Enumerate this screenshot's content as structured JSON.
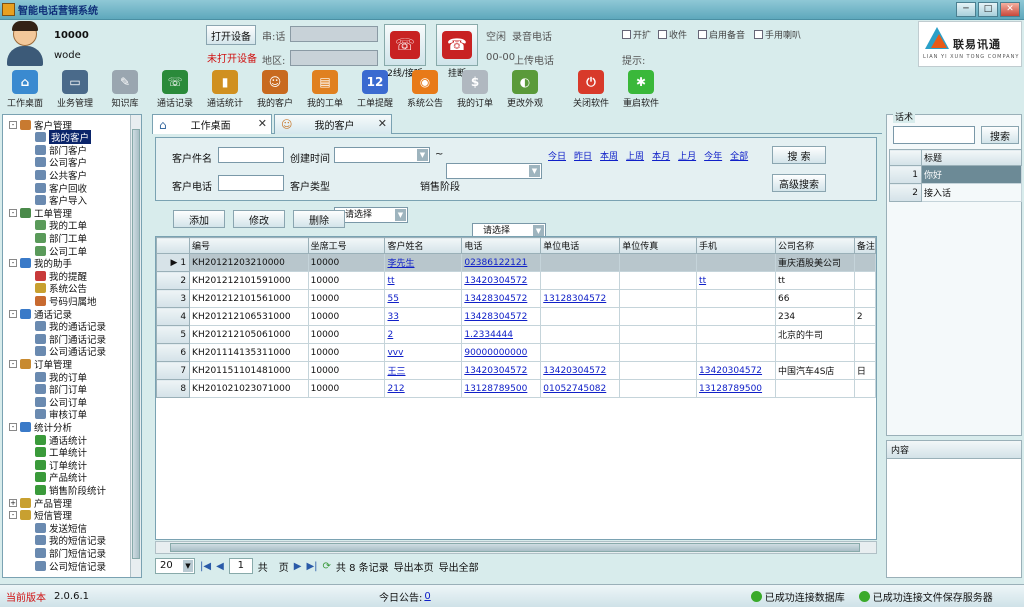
{
  "app": {
    "title": "智能电话营销系统"
  },
  "window": {
    "min_label": "─",
    "max_label": "□",
    "close_label": "✕"
  },
  "user": {
    "id": "10000",
    "name": "wode"
  },
  "device": {
    "open_button": "打开设备",
    "status": "未打开设备",
    "line_label": "串:话",
    "area_label": "地区:",
    "dial_label": "2线/接听",
    "hangup_label": "挂断",
    "idle_label": "空闲",
    "record_label": "录音电话",
    "hotline_label": "00-00",
    "upload_label": "上传电话",
    "tip_label": "提示:"
  },
  "options": {
    "check1": "开扩",
    "check2": "收件",
    "check3": "启用备音",
    "check4": "手用喇叭"
  },
  "logo": {
    "cn": "联易讯通",
    "en": "LIAN YI XUN TONG COMPANY"
  },
  "toolbar": [
    {
      "label": "工作桌面",
      "icon": "house-icon",
      "color": "#3a8ad0",
      "glyph": "⌂"
    },
    {
      "label": "业务管理",
      "icon": "monitor-icon",
      "color": "#4a6a8a",
      "glyph": "▭"
    },
    {
      "label": "知识库",
      "icon": "knowledge-icon",
      "color": "#9aa6b0",
      "glyph": "✎"
    },
    {
      "label": "通话记录",
      "icon": "call-record-icon",
      "color": "#2a8a3a",
      "glyph": "☏"
    },
    {
      "label": "通话统计",
      "icon": "bar-chart-icon",
      "color": "#d09020",
      "glyph": "▮"
    },
    {
      "label": "我的客户",
      "icon": "customers-icon",
      "color": "#c86a20",
      "glyph": "☺"
    },
    {
      "label": "我的工单",
      "icon": "orders-icon",
      "color": "#e08020",
      "glyph": "▤"
    },
    {
      "label": "工单提醒",
      "icon": "calendar-icon",
      "color": "#3a6ad0",
      "glyph": "12"
    },
    {
      "label": "系统公告",
      "icon": "rss-icon",
      "color": "#e87a18",
      "glyph": "◉"
    },
    {
      "label": "我的订单",
      "icon": "dollar-doc-icon",
      "color": "#b0b8c0",
      "glyph": "$"
    },
    {
      "label": "更改外观",
      "icon": "skin-icon",
      "color": "#5a9a3a",
      "glyph": "◐"
    },
    {
      "label": "关闭软件",
      "icon": "power-icon",
      "color": "#d83a2a",
      "glyph": "⏻"
    },
    {
      "label": "重启软件",
      "icon": "restart-icon",
      "color": "#3ab83a",
      "glyph": "✱"
    }
  ],
  "tree": [
    {
      "label": "客户管理",
      "level": 0,
      "expander": "-",
      "color": "#c87a30"
    },
    {
      "label": "我的客户",
      "level": 1,
      "selected": true,
      "color": "#6a8ab0"
    },
    {
      "label": "部门客户",
      "level": 1,
      "color": "#6a8ab0"
    },
    {
      "label": "公司客户",
      "level": 1,
      "color": "#6a8ab0"
    },
    {
      "label": "公共客户",
      "level": 1,
      "color": "#6a8ab0"
    },
    {
      "label": "客户回收",
      "level": 1,
      "color": "#6a8ab0"
    },
    {
      "label": "客户导入",
      "level": 1,
      "color": "#6a8ab0"
    },
    {
      "label": "工单管理",
      "level": 0,
      "expander": "-",
      "color": "#4a8a4a"
    },
    {
      "label": "我的工单",
      "level": 1,
      "color": "#5a9a5a"
    },
    {
      "label": "部门工单",
      "level": 1,
      "color": "#5a9a5a"
    },
    {
      "label": "公司工单",
      "level": 1,
      "color": "#5a9a5a"
    },
    {
      "label": "我的助手",
      "level": 0,
      "expander": "-",
      "color": "#3a7ac8"
    },
    {
      "label": "我的提醒",
      "level": 1,
      "color": "#c83a3a"
    },
    {
      "label": "系统公告",
      "level": 1,
      "color": "#c8a030"
    },
    {
      "label": "号码归属地",
      "level": 1,
      "color": "#c86a30"
    },
    {
      "label": "通话记录",
      "level": 0,
      "expander": "-",
      "color": "#3a7ac8"
    },
    {
      "label": "我的通话记录",
      "level": 1,
      "color": "#6a8ab0"
    },
    {
      "label": "部门通话记录",
      "level": 1,
      "color": "#6a8ab0"
    },
    {
      "label": "公司通话记录",
      "level": 1,
      "color": "#6a8ab0"
    },
    {
      "label": "订单管理",
      "level": 0,
      "expander": "-",
      "color": "#c88a30"
    },
    {
      "label": "我的订单",
      "level": 1,
      "color": "#6a8ab0"
    },
    {
      "label": "部门订单",
      "level": 1,
      "color": "#6a8ab0"
    },
    {
      "label": "公司订单",
      "level": 1,
      "color": "#6a8ab0"
    },
    {
      "label": "审核订单",
      "level": 1,
      "color": "#6a8ab0"
    },
    {
      "label": "统计分析",
      "level": 0,
      "expander": "-",
      "color": "#3a7ac8"
    },
    {
      "label": "通话统计",
      "level": 1,
      "color": "#3a9a3a"
    },
    {
      "label": "工单统计",
      "level": 1,
      "color": "#3a9a3a"
    },
    {
      "label": "订单统计",
      "level": 1,
      "color": "#3a9a3a"
    },
    {
      "label": "产品统计",
      "level": 1,
      "color": "#3a9a3a"
    },
    {
      "label": "销售阶段统计",
      "level": 1,
      "color": "#3a9a3a"
    },
    {
      "label": "产品管理",
      "level": 0,
      "expander": "+",
      "color": "#c8a030"
    },
    {
      "label": "短信管理",
      "level": 0,
      "expander": "-",
      "color": "#c8a030"
    },
    {
      "label": "发送短信",
      "level": 1,
      "color": "#6a8ab0"
    },
    {
      "label": "我的短信记录",
      "level": 1,
      "color": "#6a8ab0"
    },
    {
      "label": "部门短信记录",
      "level": 1,
      "color": "#6a8ab0"
    },
    {
      "label": "公司短信记录",
      "level": 1,
      "color": "#6a8ab0"
    }
  ],
  "tabs": [
    {
      "label": "工作桌面",
      "icon": "home-icon"
    },
    {
      "label": "我的客户",
      "icon": "user-icon"
    }
  ],
  "search": {
    "name_label": "客户件名",
    "time_label": "创建时间",
    "range_sep": "~",
    "phone_label": "客户电话",
    "type_label": "客户类型",
    "type_value": "请选择",
    "stage_label": "销售阶段",
    "stage_value": "请选择",
    "quick_links": [
      "今日",
      "昨日",
      "本周",
      "上周",
      "本月",
      "上月",
      "今年",
      "全部"
    ],
    "search_button": "搜 索",
    "advanced_button": "高级搜索"
  },
  "actions": {
    "add": "添加",
    "edit": "修改",
    "delete": "删除"
  },
  "table": {
    "headers": [
      "编号",
      "坐席工号",
      "客户姓名",
      "电话",
      "单位电话",
      "单位传真",
      "手机",
      "公司名称",
      "备注"
    ],
    "rows": [
      [
        "KH20121203210000",
        "10000",
        "李先生",
        "02386122121",
        "",
        "",
        "",
        "重庆酒股美公司",
        ""
      ],
      [
        "KH201212101591000",
        "10000",
        "tt",
        "13420304572",
        "",
        "",
        "tt",
        "tt",
        ""
      ],
      [
        "KH201212101561000",
        "10000",
        "55",
        "13428304572",
        "13128304572",
        "",
        "",
        "66",
        ""
      ],
      [
        "KH201212106531000",
        "10000",
        "33",
        "13428304572",
        "",
        "",
        "",
        "234",
        "2"
      ],
      [
        "KH201212105061000",
        "10000",
        "2",
        "1.2334444",
        "",
        "",
        "",
        "北京的牛司",
        ""
      ],
      [
        "KH201114135311000",
        "10000",
        "vvv",
        "90000000000",
        "",
        "",
        "",
        "",
        ""
      ],
      [
        "KH201151101481000",
        "10000",
        "王三",
        "13420304572",
        "13420304572",
        "",
        "13420304572",
        "中国汽车4S店",
        "日"
      ],
      [
        "KH201021023071000",
        "10000",
        "212",
        "13128789500",
        "01052745082",
        "",
        "13128789500",
        "",
        ""
      ]
    ]
  },
  "pager": {
    "page_size": "20",
    "current": "1",
    "total_prefix": "共",
    "total_suffix": "页",
    "records": "共 8 条记录",
    "export_page": "导出本页",
    "export_all": "导出全部"
  },
  "right": {
    "group_title": "话术",
    "search_button": "搜索",
    "col_header": "标题",
    "items": [
      {
        "n": "1",
        "title": "你好"
      },
      {
        "n": "2",
        "title": "接入话"
      }
    ],
    "content_label": "内容"
  },
  "status": {
    "version_label": "当前版本",
    "version": "2.0.6.1",
    "announce_label": "今日公告:",
    "announce_value": "0",
    "db_ok": "已成功连接数据库",
    "server_ok": "已成功连接文件保存服务器"
  }
}
